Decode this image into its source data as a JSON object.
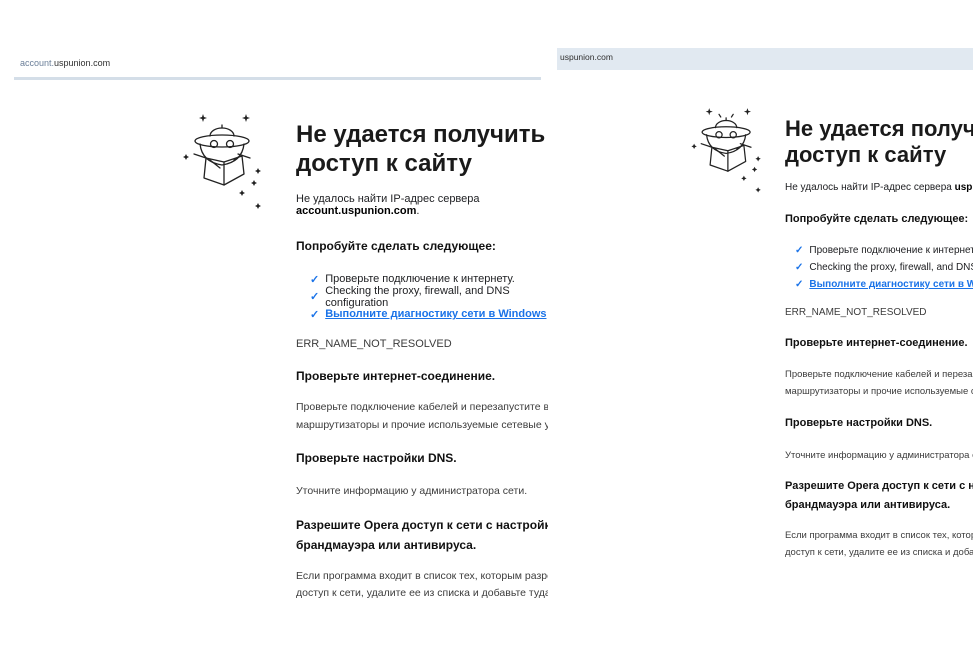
{
  "left": {
    "address": {
      "prefix": "account.",
      "domain": "uspunion.com"
    },
    "title_line1": "Не удается получить",
    "title_line2": "доступ к сайту",
    "desc_prefix": "Не удалось найти IP-адрес сервера ",
    "host": "account.uspunion.com",
    "desc_suffix": ".",
    "try_heading": "Попробуйте сделать следующее:",
    "suggestions": [
      "Проверьте подключение к интернету.",
      "Checking the proxy, firewall, and DNS configuration",
      "Выполните диагностику сети в Windows"
    ],
    "error_code": "ERR_NAME_NOT_RESOLVED",
    "sections": [
      {
        "title": "Проверьте интернет-соединение.",
        "body_line1": "Проверьте подключение кабелей и перезапустите все",
        "body_line2": "маршрутизаторы и прочие используемые сетевые устройств"
      },
      {
        "title": "Проверьте настройки DNS.",
        "body_line1": "Уточните информацию у администратора сети."
      },
      {
        "title_line1": "Разрешите Opera доступ к сети с настройками",
        "title_line2": "брандмауэра или антивируса.",
        "body_line1": "Если программа входит в список тех, которым разрешен",
        "body_line2": "доступ к сети, удалите ее из списка и добавьте туда снова."
      }
    ]
  },
  "right": {
    "address": "uspunion.com",
    "title_line1": "Не удается получить",
    "title_line2": "доступ к сайту",
    "desc_prefix": "Не удалось найти IP-адрес сервера ",
    "host": "uspunion.com",
    "desc_suffix": ".",
    "try_heading": "Попробуйте сделать следующее:",
    "suggestions": [
      "Проверьте подключение к интернету.",
      "Checking the proxy, firewall, and DNS configura",
      "Выполните диагностику сети в Windows"
    ],
    "error_code": "ERR_NAME_NOT_RESOLVED",
    "sections": [
      {
        "title": "Проверьте интернет-соединение.",
        "body_line1": "Проверьте подключение кабелей и перезапустите",
        "body_line2": "маршрутизаторы и прочие используемые сетевые у"
      },
      {
        "title": "Проверьте настройки DNS.",
        "body_line1": "Уточните информацию у администратора сети."
      },
      {
        "title_line1": "Разрешите Opera доступ к сети с настройк",
        "title_line2": "брандмауэра или антивируса.",
        "body_line1": "Если программа входит в список тех, которым разр",
        "body_line2": "доступ к сети, удалите ее из списка и добавьте туда"
      }
    ]
  },
  "icons": {
    "error_illustration": "ufo-robot-with-box",
    "check": "checkmark-icon"
  },
  "colors": {
    "link": "#1a73e8",
    "check": "#1a73e8",
    "address_bar": "#e1e9f1"
  }
}
